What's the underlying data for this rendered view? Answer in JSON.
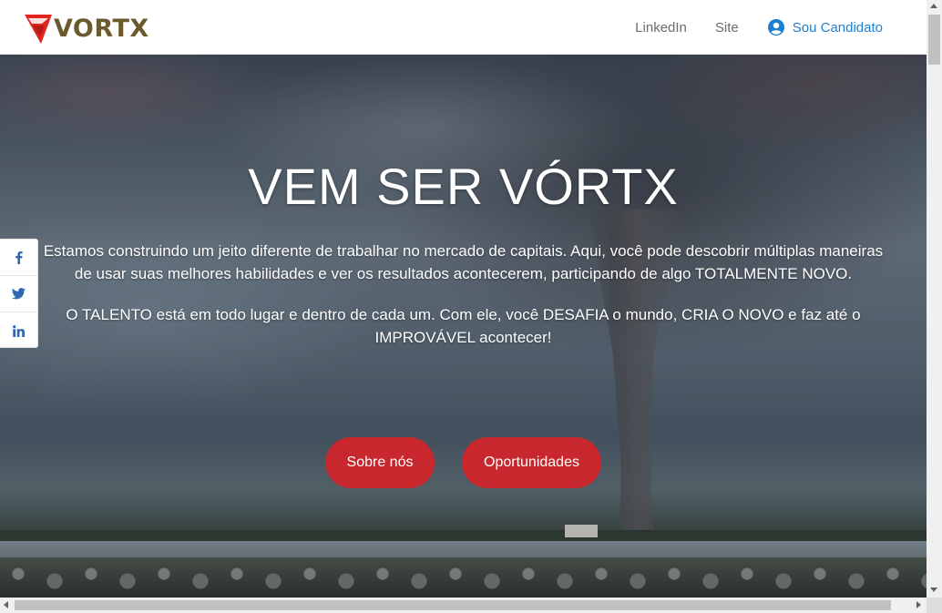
{
  "header": {
    "logo_text": "VORTX",
    "nav": [
      {
        "label": "LinkedIn"
      },
      {
        "label": "Site"
      }
    ],
    "candidate": {
      "label": "Sou Candidato",
      "icon": "user-circle-icon"
    }
  },
  "hero": {
    "title": "VEM SER VÓRTX",
    "paragraph1": "Estamos construindo um jeito diferente de trabalhar no mercado de capitais. Aqui, você pode descobrir múltiplas maneiras de usar suas melhores habilidades e ver os resultados acontecerem, participando de algo TOTALMENTE NOVO.",
    "paragraph2": "O TALENTO está em todo lugar e dentro de cada um. Com ele, você DESAFIA o mundo, CRIA O NOVO e faz até o IMPROVÁVEL acontecer!",
    "buttons": [
      {
        "label": "Sobre nós"
      },
      {
        "label": "Oportunidades"
      }
    ],
    "background": "tornado-over-lake-photo"
  },
  "share": [
    {
      "icon": "facebook-icon"
    },
    {
      "icon": "twitter-icon"
    },
    {
      "icon": "linkedin-icon"
    }
  ],
  "colors": {
    "accent": "#c8272d",
    "link": "#1c7fd2",
    "nav_text": "#6b6b6b",
    "logo_gold": "#6b5a2b",
    "share_icon": "#2f67b3"
  }
}
